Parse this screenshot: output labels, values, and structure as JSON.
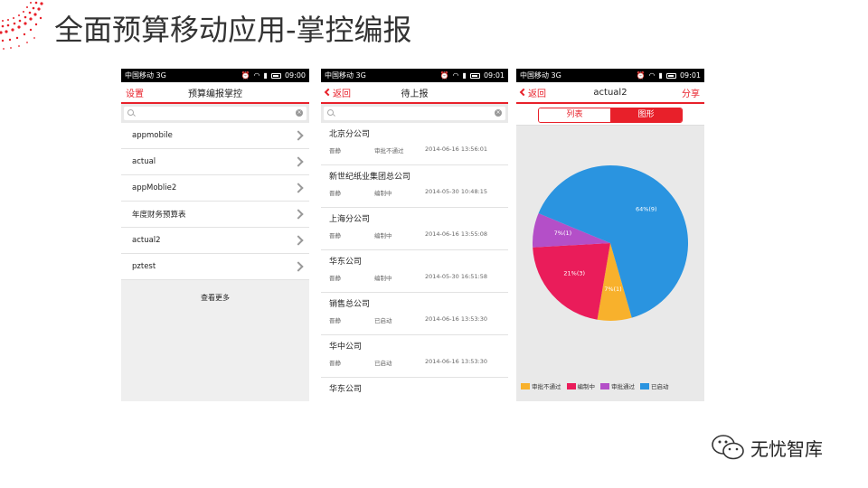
{
  "slide": {
    "title": "全面预算移动应用-掌控编报",
    "brand_text": "无忧智库",
    "accent": "#e8202a"
  },
  "status_bars": [
    {
      "carrier": "中国移动 3G",
      "time": "09:00"
    },
    {
      "carrier": "中国移动 3G",
      "time": "09:01"
    },
    {
      "carrier": "中国移动 3G",
      "time": "09:01"
    }
  ],
  "phone1": {
    "nav_left": "设置",
    "nav_title": "预算编报掌控",
    "items": [
      "appmobile",
      "actual",
      "appMoblie2",
      "年度财务预算表",
      "actual2",
      "pztest"
    ],
    "more_label": "查看更多"
  },
  "phone2": {
    "back_label": "返回",
    "nav_title": "待上报",
    "items": [
      {
        "name": "北京分公司",
        "user": "晋静",
        "status": "审批不通过",
        "date": "2014-06-16 13:56:01"
      },
      {
        "name": "新世纪纸业集团总公司",
        "user": "晋静",
        "status": "编制中",
        "date": "2014-05-30 10:48:15"
      },
      {
        "name": "上海分公司",
        "user": "晋静",
        "status": "编制中",
        "date": "2014-06-16 13:55:08"
      },
      {
        "name": "华东公司",
        "user": "晋静",
        "status": "编制中",
        "date": "2014-05-30 16:51:58"
      },
      {
        "name": "销售总公司",
        "user": "晋静",
        "status": "已启动",
        "date": "2014-06-16 13:53:30"
      },
      {
        "name": "华中公司",
        "user": "晋静",
        "status": "已启动",
        "date": "2014-06-16 13:53:30"
      },
      {
        "name": "华东公司",
        "user": "",
        "status": "",
        "date": ""
      }
    ]
  },
  "phone3": {
    "back_label": "返回",
    "nav_title": "actual2",
    "share_label": "分享",
    "tab_list": "列表",
    "tab_chart": "图形"
  },
  "chart_data": {
    "type": "pie",
    "slices": [
      {
        "name": "审批不通过",
        "label": "7%(1)",
        "value": 1,
        "color": "#f8b12c"
      },
      {
        "name": "编制中",
        "label": "21%(3)",
        "value": 3,
        "color": "#ea1c5a"
      },
      {
        "name": "审批通过",
        "label": "7%(1)",
        "value": 1,
        "color": "#b44fc8"
      },
      {
        "name": "已启动",
        "label": "64%(9)",
        "value": 9,
        "color": "#2a94e0"
      }
    ],
    "legend_position": "bottom-left"
  }
}
